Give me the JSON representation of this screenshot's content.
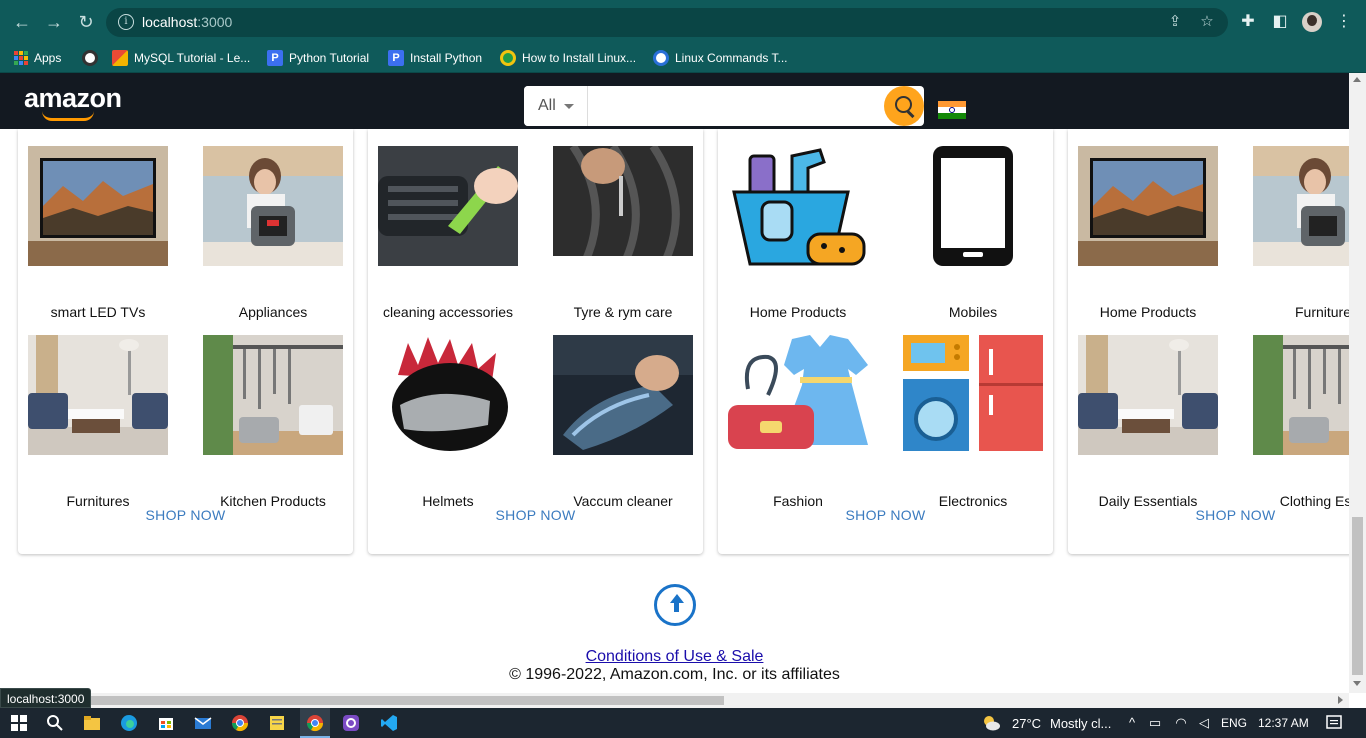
{
  "browser": {
    "url_host": "localhost",
    "url_port": ":3000",
    "status_tooltip": "localhost:3000",
    "bookmarks": [
      {
        "label": "Apps"
      },
      {
        "label": ""
      },
      {
        "label": "MySQL Tutorial - Le..."
      },
      {
        "label": "Python Tutorial"
      },
      {
        "label": "Install Python"
      },
      {
        "label": "How to Install Linux..."
      },
      {
        "label": "Linux Commands T..."
      }
    ]
  },
  "header": {
    "logo_text": "amazon",
    "search_category": "All",
    "search_placeholder": ""
  },
  "cards": [
    {
      "tiles": [
        {
          "label": "smart LED TVs",
          "image": "tv-image"
        },
        {
          "label": "Appliances",
          "image": "pressure-cooker-image"
        },
        {
          "label": "Furnitures",
          "image": "sofa-image"
        },
        {
          "label": "Kitchen Products",
          "image": "kitchen-utensils-image"
        }
      ],
      "shop_now": "SHOP NOW"
    },
    {
      "tiles": [
        {
          "label": "cleaning accessories",
          "image": "cleaning-brush-image"
        },
        {
          "label": "Tyre & rym care",
          "image": "tyre-image"
        },
        {
          "label": "Helmets",
          "image": "helmet-image"
        },
        {
          "label": "Vaccum cleaner",
          "image": "vacuum-image"
        }
      ],
      "shop_now": "SHOP NOW"
    },
    {
      "tiles": [
        {
          "label": "Home Products",
          "image": "cleaning-bucket-icon"
        },
        {
          "label": "Mobiles",
          "image": "mobile-phone-icon"
        },
        {
          "label": "Fashion",
          "image": "dress-bag-icon"
        },
        {
          "label": "Electronics",
          "image": "appliances-icon"
        }
      ],
      "shop_now": "SHOP NOW"
    },
    {
      "tiles": [
        {
          "label": "Home Products",
          "image": "tv-image"
        },
        {
          "label": "Furniture",
          "image": "pressure-cooker-image"
        },
        {
          "label": "Daily Essentials",
          "image": "sofa-image"
        },
        {
          "label": "Clothing Esse",
          "image": "kitchen-utensils-image"
        }
      ],
      "shop_now": "SHOP NOW"
    }
  ],
  "footer": {
    "conditions": "Conditions of Use & Sale",
    "copyright": "© 1996-2022, Amazon.com, Inc. or its affiliates"
  },
  "taskbar": {
    "weather_temp": "27°C",
    "weather_desc": "Mostly cl...",
    "language": "ENG",
    "time": "12:37 AM"
  },
  "colors": {
    "chrome_bg": "#0f5a5a",
    "amazon_header": "#131921",
    "search_button": "#ffa41c",
    "shop_now": "#3b7bbf",
    "link": "#1a0dab",
    "taskbar": "#1c2630"
  }
}
